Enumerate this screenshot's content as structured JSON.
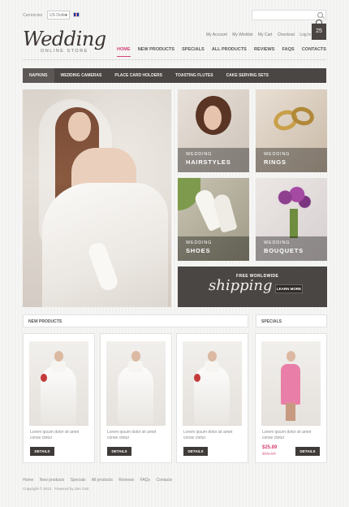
{
  "topbar": {
    "currency_label": "Currencies",
    "currency_value": "US Dollar"
  },
  "search": {
    "placeholder": ""
  },
  "logo": {
    "title": "Wedding",
    "subtitle": "ONLINE STORE"
  },
  "account_links": [
    "My Account",
    "My Wishlist",
    "My Cart",
    "Checkout",
    "Log In"
  ],
  "cart": {
    "count": "25"
  },
  "main_nav": {
    "items": [
      "HOME",
      "NEW PRODUCTS",
      "SPECIALS",
      "ALL PRODUCTS",
      "REVIEWS",
      "FAQS",
      "CONTACTS"
    ],
    "active": "HOME"
  },
  "categories": [
    "NAPKINS",
    "WEDDING CAMERAS",
    "PLACE CARD HOLDERS",
    "TOASTING FLUTES",
    "CAKE SERVING SETS"
  ],
  "tiles": [
    {
      "small": "WEDDING",
      "big": "HAIRSTYLES"
    },
    {
      "small": "WEDDING",
      "big": "RINGS"
    },
    {
      "small": "WEDDING",
      "big": "SHOES"
    },
    {
      "small": "WEDDING",
      "big": "BOUQUETS"
    }
  ],
  "shipping_banner": {
    "top": "FREE WORLDWIDE",
    "script": "shipping",
    "button": "LEARN MORE"
  },
  "sections": {
    "new_products": "NEW PRODUCTS",
    "specials": "SPECIALS"
  },
  "products": [
    {
      "desc": "Lorem ipsum dolor sit amet conse ctetur",
      "button": "DETAILS"
    },
    {
      "desc": "Lorem ipsum dolor sit amet conse ctetur",
      "button": "DETAILS"
    },
    {
      "desc": "Lorem ipsum dolor sit amet conse ctetur",
      "button": "DETAILS"
    }
  ],
  "special": {
    "desc": "Lorem ipsum dolor sit amet conse ctetur",
    "price": "$25.89",
    "old_price": "$55.99",
    "button": "DETAILS"
  },
  "footer": {
    "links": [
      "Home",
      "New products",
      "Specials",
      "All products",
      "Reviews",
      "FAQs",
      "Contacts"
    ],
    "copyright": "Copyright © 2013 . Powered by Zen Cart"
  },
  "colors": {
    "accent": "#d5427a",
    "dark": "#4a4644"
  }
}
